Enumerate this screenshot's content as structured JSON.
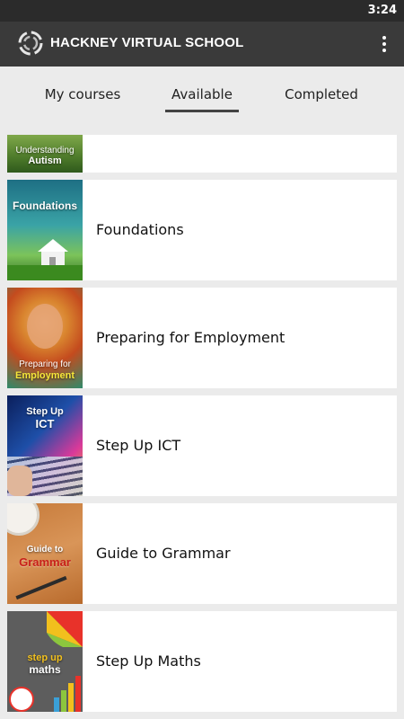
{
  "status_bar": {
    "time": "3:24"
  },
  "app_bar": {
    "title": "HACKNEY VIRTUAL SCHOOL"
  },
  "tabs": [
    {
      "label": "My courses",
      "selected": false
    },
    {
      "label": "Available",
      "selected": true
    },
    {
      "label": "Completed",
      "selected": false
    }
  ],
  "courses": [
    {
      "title": "",
      "thumb_line1": "Understanding",
      "thumb_line2": "Autism"
    },
    {
      "title": "Foundations",
      "thumb_line1": "Foundations"
    },
    {
      "title": "Preparing for Employment",
      "thumb_line1": "Preparing for",
      "thumb_line2": "Employment"
    },
    {
      "title": "Step Up ICT",
      "thumb_line1": "Step Up",
      "thumb_line2": "ICT"
    },
    {
      "title": "Guide to Grammar",
      "thumb_line1": "Guide to",
      "thumb_line2": "Grammar"
    },
    {
      "title": "Step Up Maths",
      "thumb_line1": "step up",
      "thumb_line2": "maths"
    }
  ]
}
